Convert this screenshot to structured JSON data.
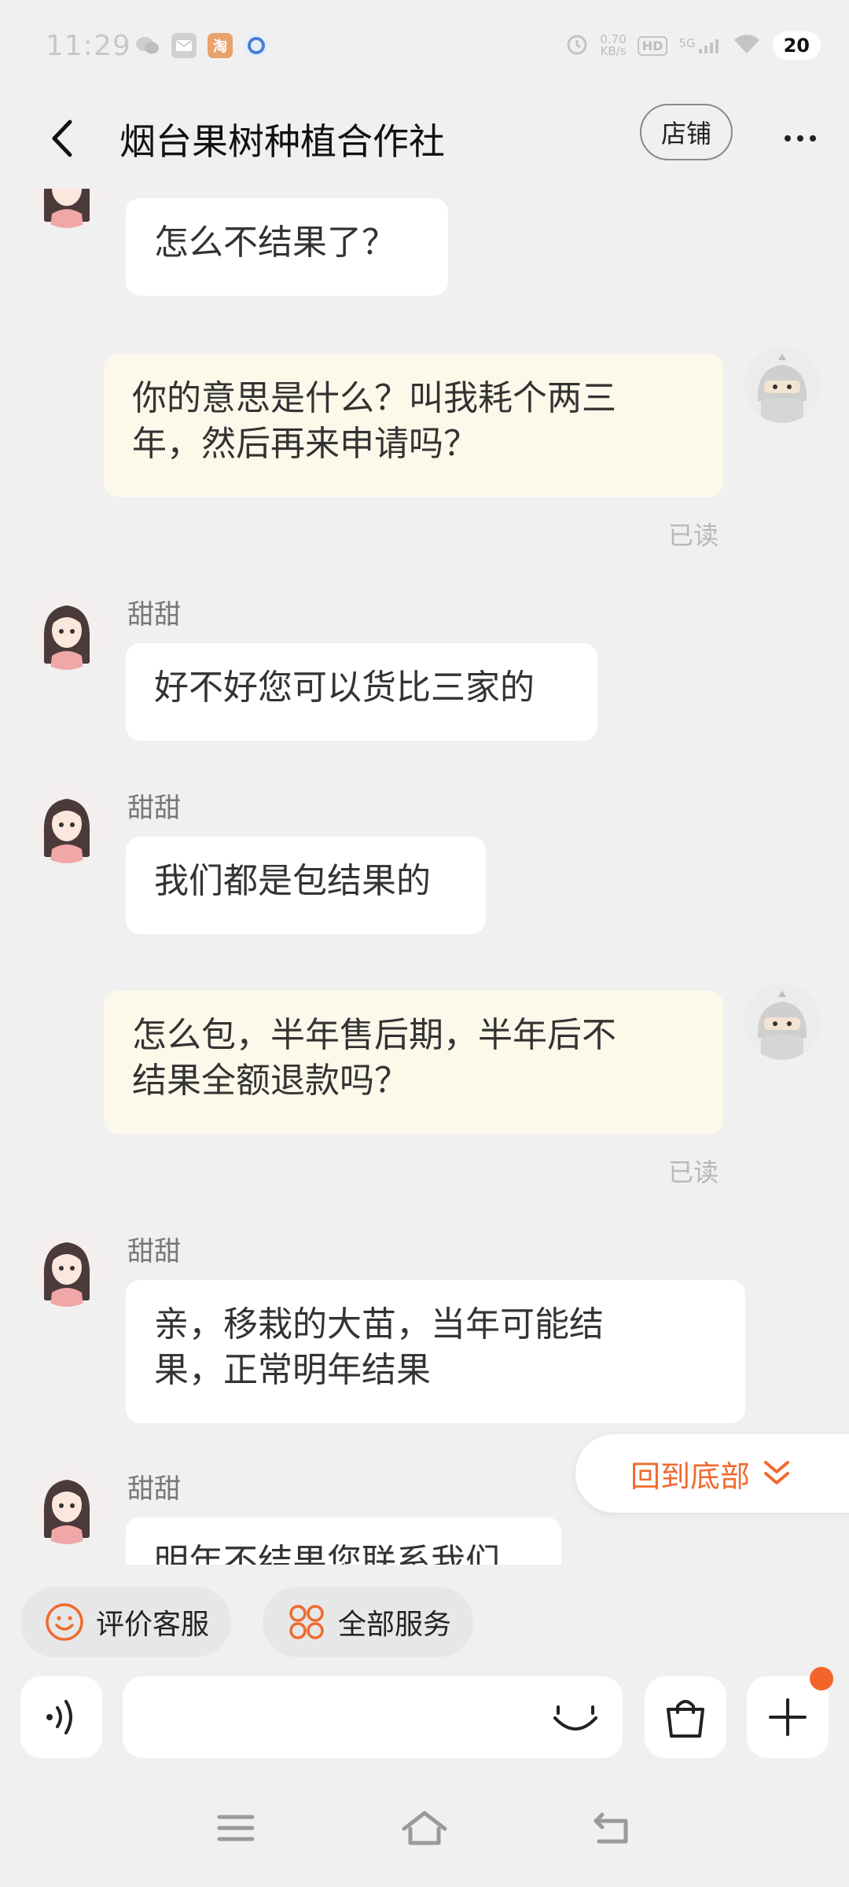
{
  "status_bar": {
    "time": "11:29",
    "net_speed": "0.70",
    "net_unit": "KB/s",
    "hd": "HD",
    "network": "5G",
    "battery": "20",
    "app_icon_taobao": "淘"
  },
  "header": {
    "title": "烟台果树种植合作社",
    "shop_label": "店铺"
  },
  "messages": [
    {
      "side": "in",
      "name": "",
      "text_lines": [
        "怎么不结果了？"
      ]
    },
    {
      "side": "out",
      "text_lines": [
        "你的意思是什么？叫我耗个两三",
        "年，然后再来申请吗？"
      ],
      "read": "已读"
    },
    {
      "side": "in",
      "name": "甜甜",
      "text_lines": [
        "好不好您可以货比三家的"
      ]
    },
    {
      "side": "in",
      "name": "甜甜",
      "text_lines": [
        "我们都是包结果的"
      ]
    },
    {
      "side": "out",
      "text_lines": [
        "怎么包，半年售后期，半年后不",
        "结果全额退款吗？"
      ],
      "read": "已读"
    },
    {
      "side": "in",
      "name": "甜甜",
      "text_lines": [
        "亲，移栽的大苗，当年可能结",
        "果，正常明年结果"
      ]
    },
    {
      "side": "in",
      "name": "甜甜",
      "text_lines": [
        "明年不结果您联系我们"
      ]
    }
  ],
  "back_to_bottom": "回到底部",
  "quick_actions": {
    "rate": "评价客服",
    "services": "全部服务"
  },
  "input": {
    "placeholder": ""
  },
  "colors": {
    "accent": "#ef6b2e",
    "out_bubble": "#fdf9ea",
    "in_bubble": "#ffffff",
    "background": "#f0f0f0"
  }
}
